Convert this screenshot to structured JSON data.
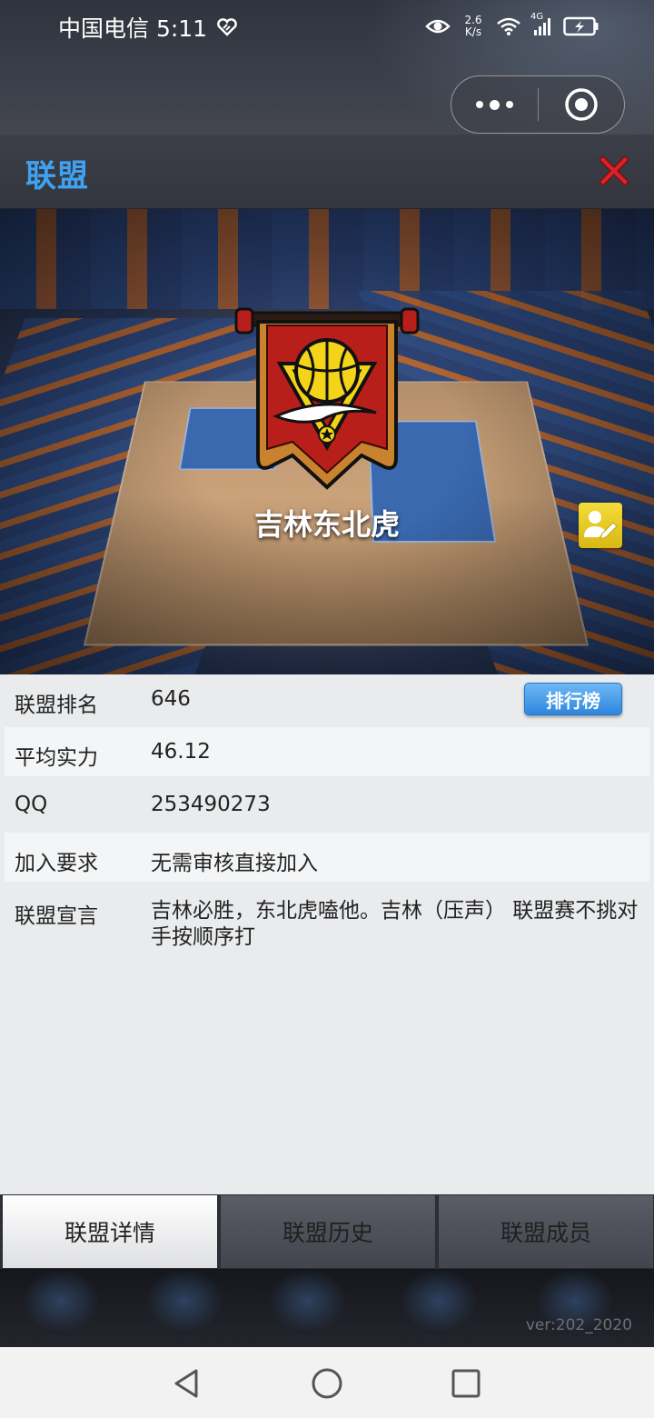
{
  "status_bar": {
    "carrier_time": "中国电信 5:11",
    "net_speed_value": "2.6",
    "net_speed_unit": "K/s",
    "signal_type": "4G"
  },
  "header": {
    "title": "联盟"
  },
  "team": {
    "name": "吉林东北虎"
  },
  "info": {
    "rank_label": "联盟排名",
    "rank_value": "646",
    "rank_button": "排行榜",
    "avg_label": "平均实力",
    "avg_value": "46.12",
    "qq_label": "QQ",
    "qq_value": "253490273",
    "join_label": "加入要求",
    "join_value": "无需审核直接加入",
    "decl_label": "联盟宣言",
    "decl_value": "吉林必胜，东北虎嗑他。吉林（压声） 联盟赛不挑对手按顺序打"
  },
  "tabs": [
    {
      "label": "联盟详情",
      "active": true
    },
    {
      "label": "联盟历史",
      "active": false
    },
    {
      "label": "联盟成员",
      "active": false
    }
  ],
  "version": "ver:202_2020",
  "colors": {
    "title_blue": "#3fa2f0",
    "close_red": "#d9232a",
    "rank_button_blue": "#2e86dd",
    "edit_yellow": "#f4dc3a",
    "badge_red": "#b81e1a"
  }
}
